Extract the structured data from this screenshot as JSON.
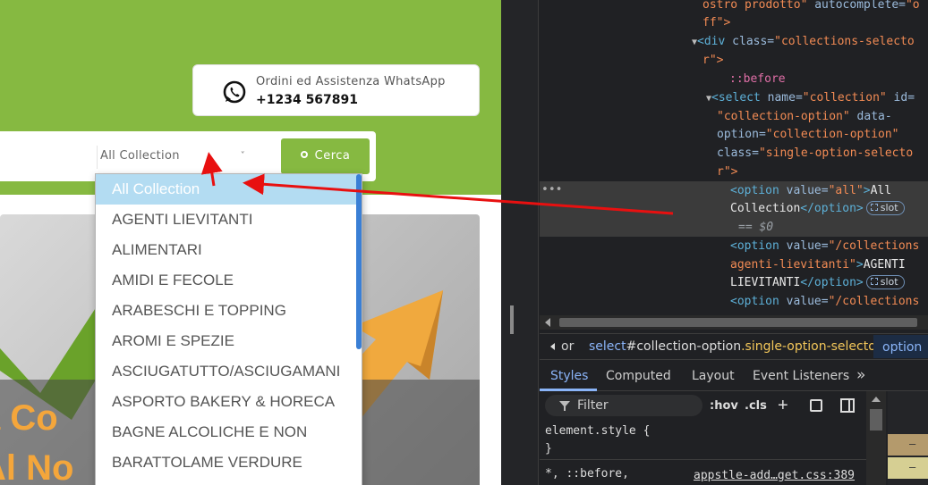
{
  "site": {
    "whatsapp": {
      "label": "Ordini ed Assistenza WhatsApp",
      "phone": "+1234 567891",
      "icon": "whatsapp-icon"
    },
    "search": {
      "collection_selected": "All Collection",
      "chevron": "˅",
      "button_label": "Cerca",
      "button_icon": "search-icon"
    },
    "banner": {
      "line1": "a Co",
      "line2": "Al No"
    },
    "dropdown": {
      "options": [
        "All Collection",
        "AGENTI LIEVITANTI",
        "ALIMENTARI",
        "AMIDI E FECOLE",
        "ARABESCHI E TOPPING",
        "AROMI E SPEZIE",
        "ASCIUGATUTTO/ASCIUGAMANI",
        "ASPORTO BAKERY & HORECA",
        "BAGNE ALCOLICHE E NON",
        "BARATTOLAME VERDURE"
      ]
    },
    "colors": {
      "brand_green": "#86b941",
      "highlight_blue": "#b3dcf2",
      "arrow_red": "#e81010"
    }
  },
  "devtools": {
    "elements": {
      "l0": {
        "a": "ostro prodotto\"",
        "b": " autocomplete=",
        "c": "\"o"
      },
      "l1": "ff\">",
      "l2": {
        "t": "<div ",
        "a": "class=",
        "v": "\"collections-selecto"
      },
      "l3": "r\">",
      "l4": "::before",
      "l5": {
        "t": "<select ",
        "a1": "name=",
        "v1": "\"collection\"",
        "a2": " id="
      },
      "l6": {
        "v": "\"collection-option\"",
        "a": " data-"
      },
      "l7": {
        "a": "option=",
        "v": "\"collection-option\""
      },
      "l8": {
        "a": "class=",
        "v": "\"single-option-selecto"
      },
      "l9": "r\">",
      "sel1": {
        "t1": "<option ",
        "a": "value=",
        "v": "\"all\"",
        "t2": ">",
        "txt": "All"
      },
      "sel2": {
        "txt": "Collection",
        "t": "</option>"
      },
      "sel3": "== $0",
      "l13": {
        "t": "<option ",
        "a": "value=",
        "v": "\"/collections"
      },
      "l14": {
        "v": "agenti-lievitanti\"",
        "t": ">",
        "txt": "AGENTI"
      },
      "l15": {
        "txt": "LIEVITANTI",
        "t": "</option>"
      },
      "l16": {
        "t": "<option ",
        "a": "value=",
        "v": "\"/collections"
      },
      "slot": "slot",
      "dots": "•••"
    },
    "breadcrumb": {
      "prefix": "or",
      "tag": "select",
      "id": "#collection-option",
      "cls": ".single-option-selector",
      "current": "option"
    },
    "tabs": [
      "Styles",
      "Computed",
      "Layout",
      "Event Listeners",
      "»"
    ],
    "filter_placeholder": "Filter",
    "tools": {
      "hov": ":hov",
      "cls": ".cls",
      "plus": "+"
    },
    "styles": {
      "l1": "element.style {",
      "l2": "}",
      "l3": "*, ::before,",
      "source": "appstle-add…get.css:389"
    },
    "boxmodel": {
      "dash": "–"
    }
  }
}
